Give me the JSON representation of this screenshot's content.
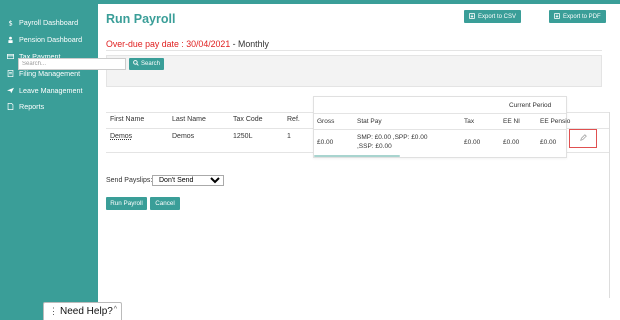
{
  "sidebar": {
    "items": [
      {
        "label": "Payroll Dashboard",
        "icon": "money-icon"
      },
      {
        "label": "Pension Dashboard",
        "icon": "pension-icon"
      },
      {
        "label": "Tax Payment",
        "icon": "card-icon"
      },
      {
        "label": "Filing Management",
        "icon": "document-icon"
      },
      {
        "label": "Leave Management",
        "icon": "plane-icon"
      },
      {
        "label": "Reports",
        "icon": "page-icon"
      }
    ]
  },
  "header": {
    "title": "Run Payroll",
    "export_csv": "Export to CSV",
    "export_pdf": "Export to PDF"
  },
  "overdue": {
    "label": "Over-due pay date : 30/04/2021",
    "suffix": " - Monthly"
  },
  "search": {
    "placeholder": "Search...",
    "button": "Search"
  },
  "table": {
    "columns": [
      "First Name",
      "Last Name",
      "Tax Code",
      "Ref."
    ],
    "rows": [
      {
        "first_name": "Demos",
        "last_name": "Demos",
        "tax_code": "1250L",
        "ref": "1"
      }
    ]
  },
  "current_period": {
    "title": "Current Period",
    "columns": [
      "Gross",
      "Stat Pay",
      "Tax",
      "EE NI",
      "EE Pensio"
    ],
    "row": {
      "gross": "£0.00",
      "stat_pay_line1": "SMP: £0.00 ,SPP:  £0.00",
      "stat_pay_line2": ",SSP: £0.00",
      "tax": "£0.00",
      "ee_ni": "£0.00",
      "ee_pension": "£0.00"
    }
  },
  "send_payslips": {
    "label": "Send Payslips:",
    "selected": "Don't Send"
  },
  "actions": {
    "run_payroll": "Run Payroll",
    "cancel": "Cancel"
  },
  "help": {
    "label": "Need Help?"
  },
  "colors": {
    "accent": "#3a9e98",
    "overdue": "#e02020",
    "highlight": "#e05050"
  }
}
